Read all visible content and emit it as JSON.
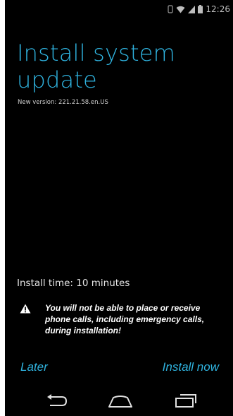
{
  "status_bar": {
    "time": "12:26",
    "icons": [
      "vibrate-icon",
      "wifi-icon",
      "signal-icon",
      "battery-icon"
    ]
  },
  "screen": {
    "title": "Install system update",
    "version": "New version: 221.21.58.en.US",
    "install_time": "Install time: 10 minutes",
    "warning_icon": "warning-triangle-icon",
    "warning_text": "You will not be able to place or receive phone calls, including emergency calls, during installation!"
  },
  "actions": {
    "later_label": "Later",
    "install_label": "Install now"
  },
  "nav_bar": {
    "icons": [
      "back-icon",
      "home-icon",
      "recent-apps-icon"
    ]
  },
  "colors": {
    "background": "#000000",
    "accent": "#2fb3df",
    "text_primary": "#e6e6e6",
    "status_text": "#bdbdbd"
  }
}
